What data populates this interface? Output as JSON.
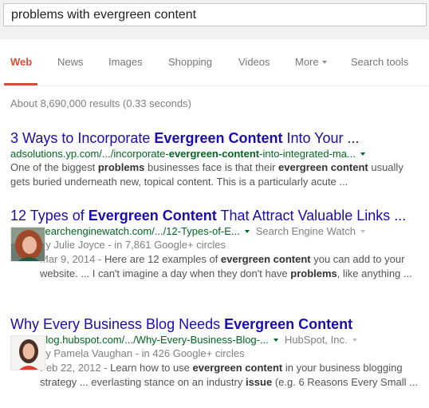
{
  "search": {
    "query": "problems with evergreen content"
  },
  "tabs": [
    {
      "label": "Web",
      "active": true
    },
    {
      "label": "News"
    },
    {
      "label": "Images"
    },
    {
      "label": "Shopping"
    },
    {
      "label": "Videos"
    },
    {
      "label": "More"
    },
    {
      "label": "Search tools"
    }
  ],
  "stats": "About 8,690,000 results (0.33 seconds)",
  "results": [
    {
      "title_parts": [
        "3 Ways to Incorporate ",
        "Evergreen Content",
        " Into Your ..."
      ],
      "url_parts": [
        "adsolutions.yp.com/.../incorporate-",
        "evergreen-content",
        "-into-integrated-ma..."
      ],
      "snippet_parts": [
        "One of the biggest ",
        "problems",
        " businesses face is that their ",
        "evergreen content",
        " usually gets buried underneath new, topical content. This is a particularly acute ..."
      ]
    },
    {
      "title_parts": [
        "12 Types of ",
        "Evergreen Content",
        " That Attract Valuable Links ..."
      ],
      "url": "searchenginewatch.com/.../12-Types-of-E...",
      "publisher": "Search Engine Watch",
      "byline": "by Julie Joyce - in 7,861 Google+ circles",
      "date": "Mar 9, 2014 - ",
      "snippet_parts": [
        "Here are 12 examples of ",
        "evergreen content",
        " you can add to your website. ... I can't imagine a day when they don't have ",
        "problems",
        ", like anything ..."
      ],
      "thumb": "author-photo-julie-joyce"
    },
    {
      "title_parts": [
        "Why Every Business Blog Needs ",
        "Evergreen Content"
      ],
      "url": "blog.hubspot.com/.../Why-Every-Business-Blog-...",
      "publisher": "HubSpot, Inc.",
      "byline": "by Pamela Vaughan - in 426 Google+ circles",
      "date": "Feb 22, 2012 - ",
      "snippet_parts": [
        "Learn how to use ",
        "evergreen content",
        " in your business blogging strategy ... everlasting stance on an industry ",
        "issue",
        " (e.g. 6 Reasons Every Small ..."
      ],
      "thumb": "author-photo-pamela-vaughan"
    }
  ],
  "colors": {
    "accent_red": "#dd4b39",
    "link_blue": "#1a0dab",
    "url_green": "#006621",
    "snippet_grey": "#545454"
  }
}
